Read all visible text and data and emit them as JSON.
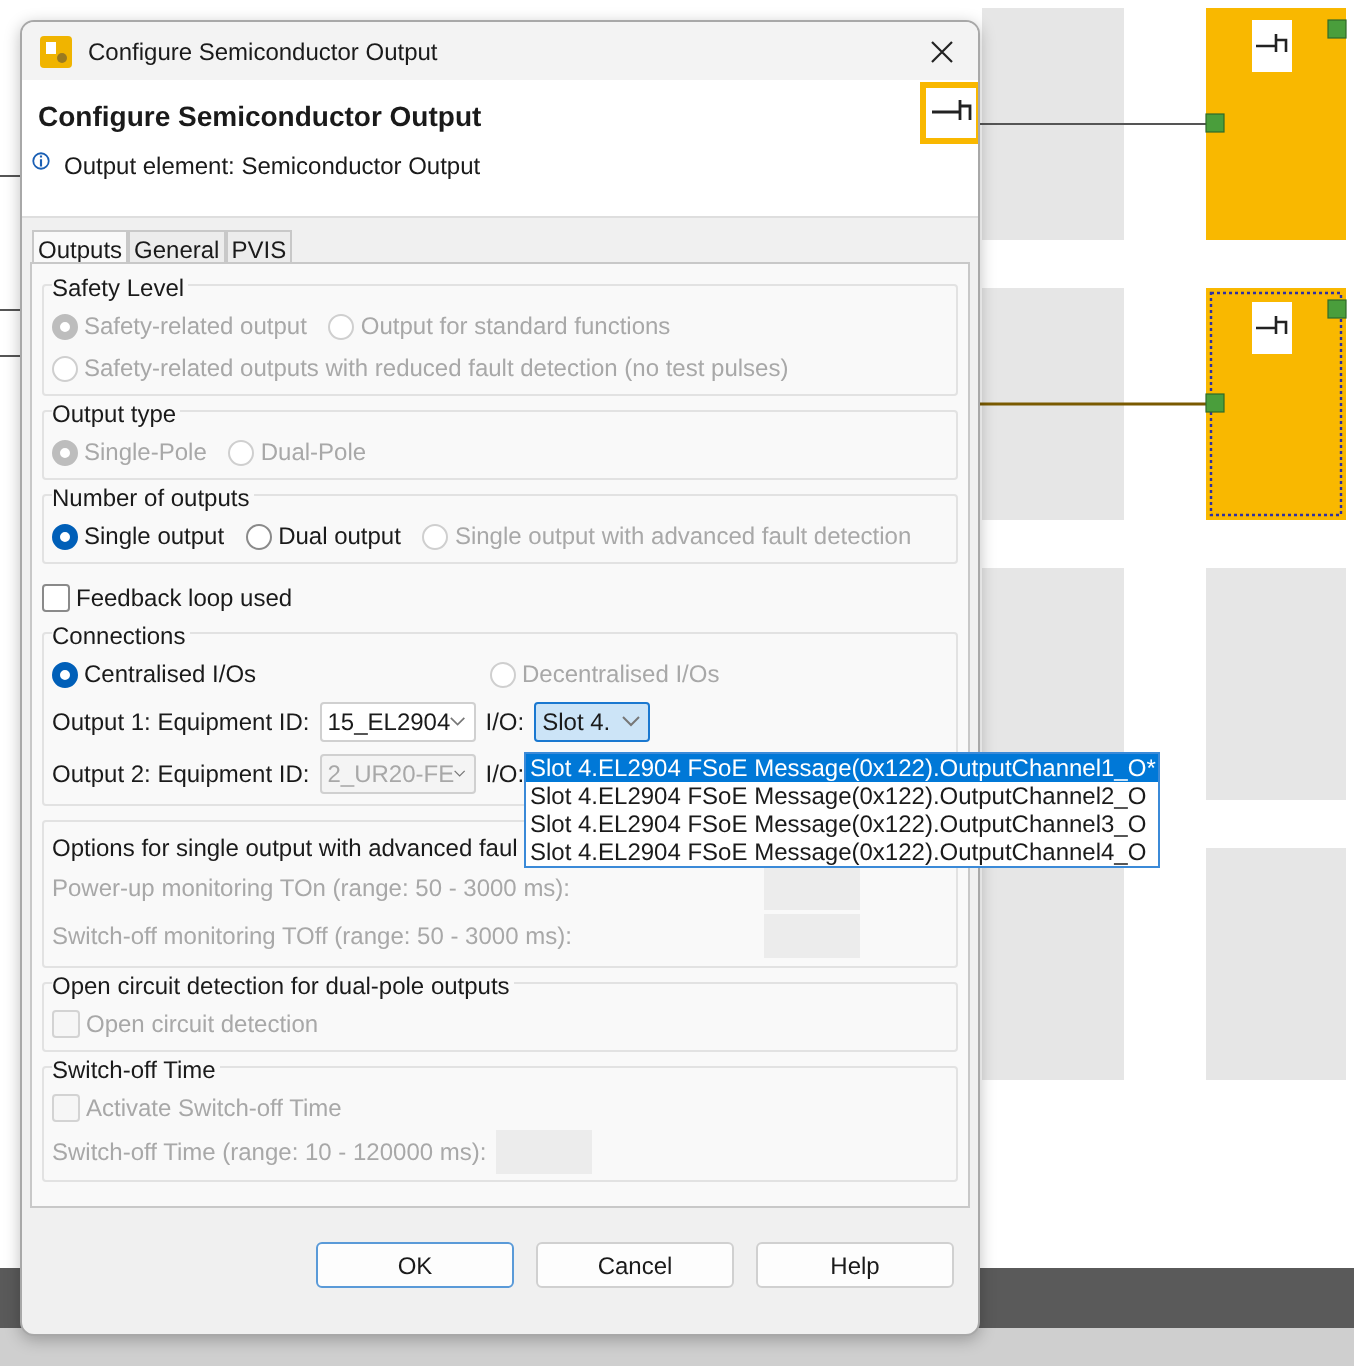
{
  "window": {
    "title": "Configure Semiconductor Output"
  },
  "header": {
    "title": "Configure Semiconductor Output",
    "info": "Output element: Semiconductor Output"
  },
  "tabs": [
    {
      "label": "Outputs",
      "selected": true
    },
    {
      "label": "General",
      "selected": false
    },
    {
      "label": "PVIS",
      "selected": false
    }
  ],
  "sections": [
    {
      "kind": "group",
      "title": "Safety Level",
      "rows": [
        [
          {
            "kind": "radio",
            "label": "Safety-related output",
            "selected": true,
            "disabled": true
          },
          {
            "kind": "radio",
            "label": "Output for standard functions",
            "selected": false,
            "disabled": true
          }
        ],
        [
          {
            "kind": "radio",
            "label": "Safety-related outputs with reduced fault detection (no test pulses)",
            "selected": false,
            "disabled": true
          }
        ]
      ]
    },
    {
      "kind": "group",
      "title": "Output type",
      "rows": [
        [
          {
            "kind": "radio",
            "label": "Single-Pole",
            "selected": true,
            "disabled": true
          },
          {
            "kind": "radio",
            "label": "Dual-Pole",
            "selected": false,
            "disabled": true
          }
        ]
      ]
    },
    {
      "kind": "group",
      "title": "Number of outputs",
      "rows": [
        [
          {
            "kind": "radio",
            "label": "Single output",
            "selected": true,
            "disabled": false
          },
          {
            "kind": "radio",
            "label": "Dual output",
            "selected": false,
            "disabled": false
          },
          {
            "kind": "radio",
            "label": "Single output with advanced fault detection",
            "selected": false,
            "disabled": true
          }
        ]
      ]
    },
    {
      "kind": "plain",
      "rows": [
        [
          {
            "kind": "checkbox",
            "label": "Feedback loop used",
            "checked": false,
            "disabled": false
          }
        ]
      ]
    },
    {
      "kind": "connections",
      "title": "Connections",
      "modes": [
        {
          "label": "Centralised I/Os",
          "selected": true,
          "disabled": false
        },
        {
          "label": "Decentralised I/Os",
          "selected": false,
          "disabled": true
        }
      ],
      "outputs": [
        {
          "label": "Output 1: Equipment ID:",
          "equipment": {
            "value": "15_EL2904",
            "disabled": false
          },
          "io_label": "I/O:",
          "io": {
            "value": "Slot 4.",
            "focused": true
          }
        },
        {
          "label": "Output 2: Equipment ID:",
          "equipment": {
            "value": "2_UR20-FE",
            "disabled": true
          },
          "io_label": "I/O:"
        }
      ]
    },
    {
      "kind": "options",
      "title": "Options for single output with advanced faul",
      "rows": [
        [
          {
            "kind": "label",
            "label": "Power-up monitoring TOn (range: 50 - 3000 ms):",
            "disabled": true
          },
          {
            "kind": "textbox",
            "disabled": true
          }
        ],
        [
          {
            "kind": "label",
            "label": "Switch-off monitoring TOff (range: 50 - 3000 ms):",
            "disabled": true
          },
          {
            "kind": "textbox",
            "disabled": true
          }
        ]
      ]
    },
    {
      "kind": "group",
      "title": "Open circuit detection for dual-pole outputs",
      "rows": [
        [
          {
            "kind": "checkbox",
            "label": "Open circuit detection",
            "checked": false,
            "disabled": true
          }
        ]
      ]
    },
    {
      "kind": "group",
      "title": "Switch-off Time",
      "rows": [
        [
          {
            "kind": "checkbox",
            "label": "Activate Switch-off Time",
            "checked": false,
            "disabled": true
          }
        ],
        [
          {
            "kind": "label",
            "label": "Switch-off Time (range: 10 - 120000 ms):",
            "disabled": true
          },
          {
            "kind": "textbox",
            "disabled": true
          }
        ]
      ]
    }
  ],
  "buttons": [
    {
      "label": "OK",
      "default": true
    },
    {
      "label": "Cancel",
      "default": false
    },
    {
      "label": "Help",
      "default": false
    }
  ],
  "dropdown_list": [
    {
      "label": "Slot 4.EL2904 FSoE Message(0x122).OutputChannel1_O*",
      "selected": true
    },
    {
      "label": "Slot 4.EL2904 FSoE Message(0x122).OutputChannel2_O",
      "selected": false
    },
    {
      "label": "Slot 4.EL2904 FSoE Message(0x122).OutputChannel3_O",
      "selected": false
    },
    {
      "label": "Slot 4.EL2904 FSoE Message(0x122).OutputChannel4_O",
      "selected": false
    }
  ]
}
